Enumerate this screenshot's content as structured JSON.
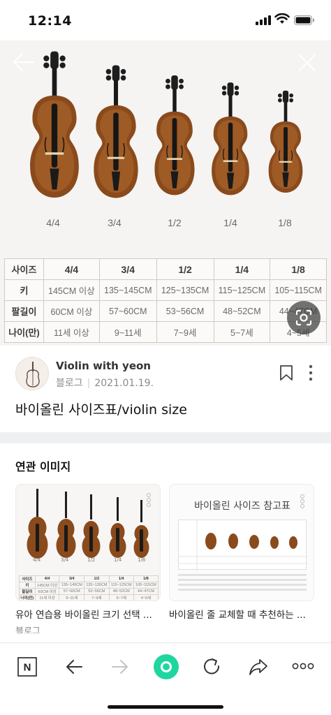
{
  "status_bar": {
    "time": "12:14"
  },
  "hero": {
    "violin_sizes": [
      "4/4",
      "3/4",
      "1/2",
      "1/4",
      "1/8"
    ],
    "table": {
      "header": [
        "사이즈",
        "4/4",
        "3/4",
        "1/2",
        "1/4",
        "1/8"
      ],
      "rows": [
        [
          "키",
          "145CM 이상",
          "135~145CM",
          "125~135CM",
          "115~125CM",
          "105~115CM"
        ],
        [
          "팔길이",
          "60CM 이상",
          "57~60CM",
          "53~56CM",
          "48~52CM",
          "44~47CM"
        ],
        [
          "나이(만)",
          "11세 이상",
          "9~11세",
          "7~9세",
          "5~7세",
          "4~5세"
        ]
      ]
    }
  },
  "source": {
    "blog_name": "Violin with yeon",
    "source_type": "블로그",
    "date": "2021.01.19.",
    "title": "바이올린 사이즈표/violin size"
  },
  "related": {
    "title": "연관 이미지",
    "cards": [
      {
        "caption": "유아 연습용 바이올린 크기 선택 ...",
        "sub": "블로그",
        "mini_sizes": [
          "4/4",
          "3/4",
          "1/2",
          "1/4",
          "1/8"
        ],
        "mini_table": [
          [
            "사이즈",
            "4/4",
            "3/4",
            "1/2",
            "1/4",
            "1/8"
          ],
          [
            "키",
            "145CM 이상",
            "135~145CM",
            "125~135CM",
            "115~125CM",
            "105~115CM"
          ],
          [
            "팔길이",
            "60CM 이상",
            "57~60CM",
            "53~56CM",
            "48~52CM",
            "44~47CM"
          ],
          [
            "나이(만)",
            "11세 이상",
            "9~11세",
            "7~9세",
            "5~7세",
            "4~5세"
          ]
        ]
      },
      {
        "caption": "바이올린 줄 교체할 때 추천하는 ...",
        "image_title": "바이올린 사이즈 참고표"
      }
    ]
  },
  "toolbar": {
    "n_label": "N"
  },
  "colors": {
    "accent_green": "#1fd6a0",
    "wood": "#8a4a1c"
  }
}
